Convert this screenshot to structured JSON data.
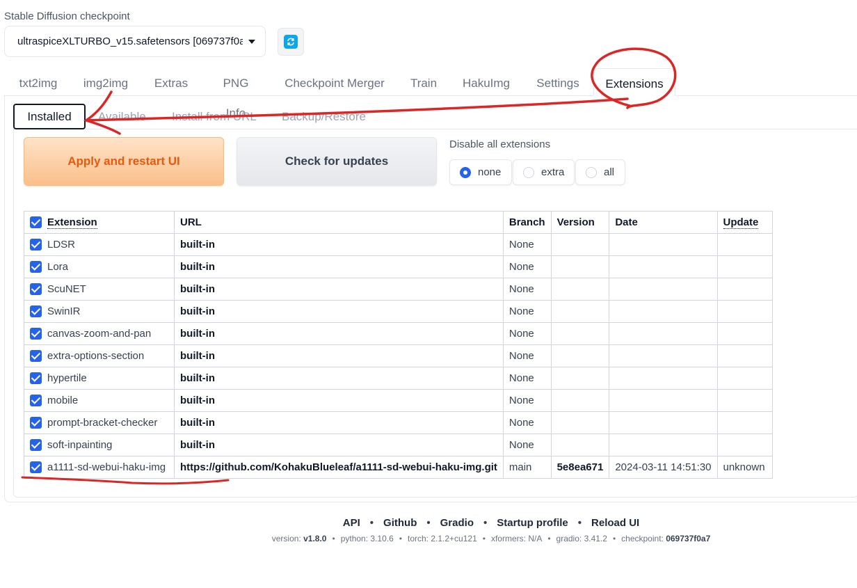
{
  "checkpoint": {
    "label": "Stable Diffusion checkpoint",
    "value": "ultraspiceXLTURBO_v15.safetensors [069737f0a"
  },
  "tabs": [
    {
      "label": "txt2img"
    },
    {
      "label": "img2img"
    },
    {
      "label": "Extras"
    },
    {
      "label": "PNG Info"
    },
    {
      "label": "Checkpoint Merger"
    },
    {
      "label": "Train"
    },
    {
      "label": "HakuImg"
    },
    {
      "label": "Settings"
    },
    {
      "label": "Extensions",
      "active": true
    }
  ],
  "subtabs": [
    {
      "label": "Installed",
      "active": true
    },
    {
      "label": "Available"
    },
    {
      "label": "Install from URL"
    },
    {
      "label": "Backup/Restore"
    }
  ],
  "actions": {
    "apply_label": "Apply and restart UI",
    "check_label": "Check for updates"
  },
  "disable_all": {
    "label": "Disable all extensions",
    "options": [
      "none",
      "extra",
      "all"
    ],
    "selected": "none"
  },
  "table": {
    "headers": {
      "extension": "Extension",
      "url": "URL",
      "branch": "Branch",
      "version": "Version",
      "date": "Date",
      "update": "Update"
    },
    "rows": [
      {
        "name": "LDSR",
        "url": "built-in",
        "branch": "None",
        "version": "",
        "date": "",
        "update": ""
      },
      {
        "name": "Lora",
        "url": "built-in",
        "branch": "None",
        "version": "",
        "date": "",
        "update": ""
      },
      {
        "name": "ScuNET",
        "url": "built-in",
        "branch": "None",
        "version": "",
        "date": "",
        "update": ""
      },
      {
        "name": "SwinIR",
        "url": "built-in",
        "branch": "None",
        "version": "",
        "date": "",
        "update": ""
      },
      {
        "name": "canvas-zoom-and-pan",
        "url": "built-in",
        "branch": "None",
        "version": "",
        "date": "",
        "update": ""
      },
      {
        "name": "extra-options-section",
        "url": "built-in",
        "branch": "None",
        "version": "",
        "date": "",
        "update": ""
      },
      {
        "name": "hypertile",
        "url": "built-in",
        "branch": "None",
        "version": "",
        "date": "",
        "update": ""
      },
      {
        "name": "mobile",
        "url": "built-in",
        "branch": "None",
        "version": "",
        "date": "",
        "update": ""
      },
      {
        "name": "prompt-bracket-checker",
        "url": "built-in",
        "branch": "None",
        "version": "",
        "date": "",
        "update": ""
      },
      {
        "name": "soft-inpainting",
        "url": "built-in",
        "branch": "None",
        "version": "",
        "date": "",
        "update": ""
      },
      {
        "name": "a1111-sd-webui-haku-img",
        "url": "https://github.com/KohakuBlueleaf/a1111-sd-webui-haku-img.git",
        "branch": "main",
        "version": "5e8ea671",
        "date": "2024-03-11 14:51:30",
        "update": "unknown"
      }
    ]
  },
  "footer": {
    "links": [
      "API",
      "Github",
      "Gradio",
      "Startup profile",
      "Reload UI"
    ],
    "versions": [
      {
        "key": "version:",
        "value": "v1.8.0",
        "bold": true
      },
      {
        "key": "python:",
        "value": "3.10.6",
        "bold": false
      },
      {
        "key": "torch:",
        "value": "2.1.2+cu121",
        "bold": false
      },
      {
        "key": "xformers:",
        "value": "N/A",
        "bold": false
      },
      {
        "key": "gradio:",
        "value": "3.41.2",
        "bold": false
      },
      {
        "key": "checkpoint:",
        "value": "069737f0a7",
        "bold": true
      }
    ]
  },
  "colors": {
    "accent": "#2563eb",
    "apply_text": "#ea580c",
    "annotation": "#dc2626"
  }
}
